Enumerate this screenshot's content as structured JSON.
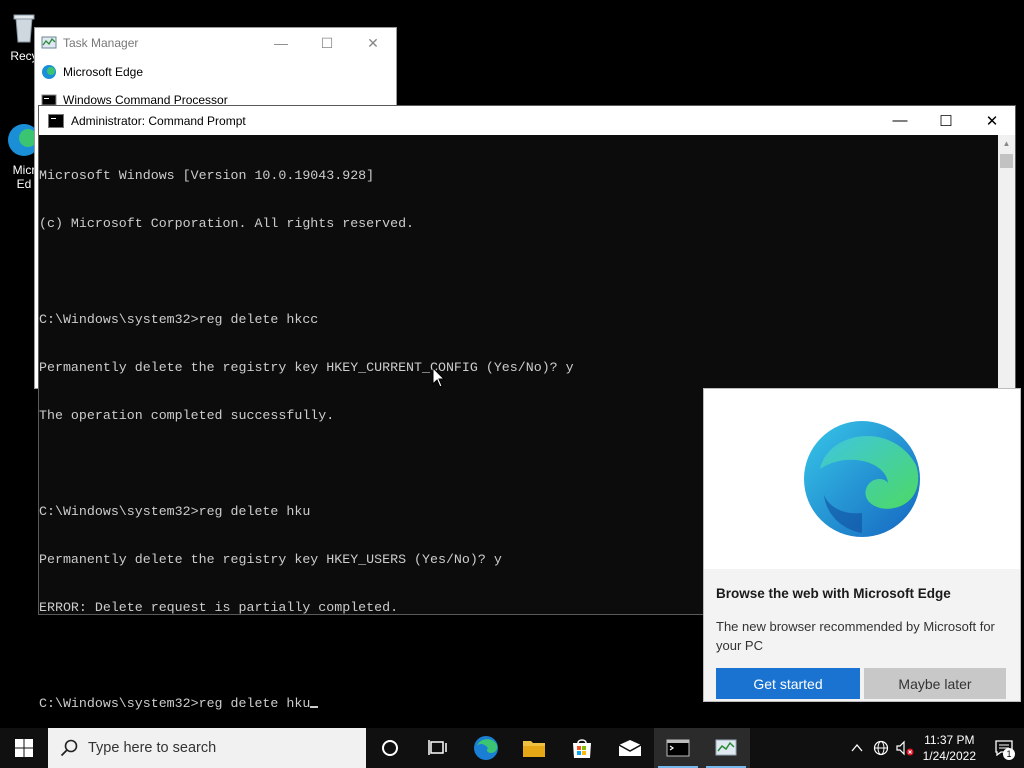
{
  "desktop": {
    "icons": [
      {
        "label": "Recy"
      },
      {
        "label": "Micr\nEd"
      }
    ]
  },
  "task_manager": {
    "title": "Task Manager",
    "minimize": "—",
    "maximize": "☐",
    "close": "✕",
    "items": [
      {
        "label": "Microsoft Edge"
      },
      {
        "label": "Windows Command Processor"
      }
    ]
  },
  "cmd": {
    "title": "Administrator: Command Prompt",
    "minimize": "—",
    "maximize": "☐",
    "close": "✕",
    "lines": [
      "Microsoft Windows [Version 10.0.19043.928]",
      "(c) Microsoft Corporation. All rights reserved.",
      "",
      "C:\\Windows\\system32>reg delete hkcc",
      "Permanently delete the registry key HKEY_CURRENT_CONFIG (Yes/No)? y",
      "The operation completed successfully.",
      "",
      "C:\\Windows\\system32>reg delete hku",
      "Permanently delete the registry key HKEY_USERS (Yes/No)? y",
      "ERROR: Delete request is partially completed.",
      "",
      "C:\\Windows\\system32>reg delete hku"
    ]
  },
  "edge_promo": {
    "title": "Browse the web with Microsoft Edge",
    "text": "The new browser recommended by Microsoft for your PC",
    "primary_button": "Get started",
    "secondary_button": "Maybe later"
  },
  "taskbar": {
    "search_placeholder": "Type here to search",
    "time": "11:37 PM",
    "date": "1/24/2022",
    "notification_count": "1"
  },
  "colors": {
    "accent": "#1a73d1",
    "console_bg": "#0c0c0c",
    "console_fg": "#cccccc",
    "taskbar": "#101010"
  }
}
